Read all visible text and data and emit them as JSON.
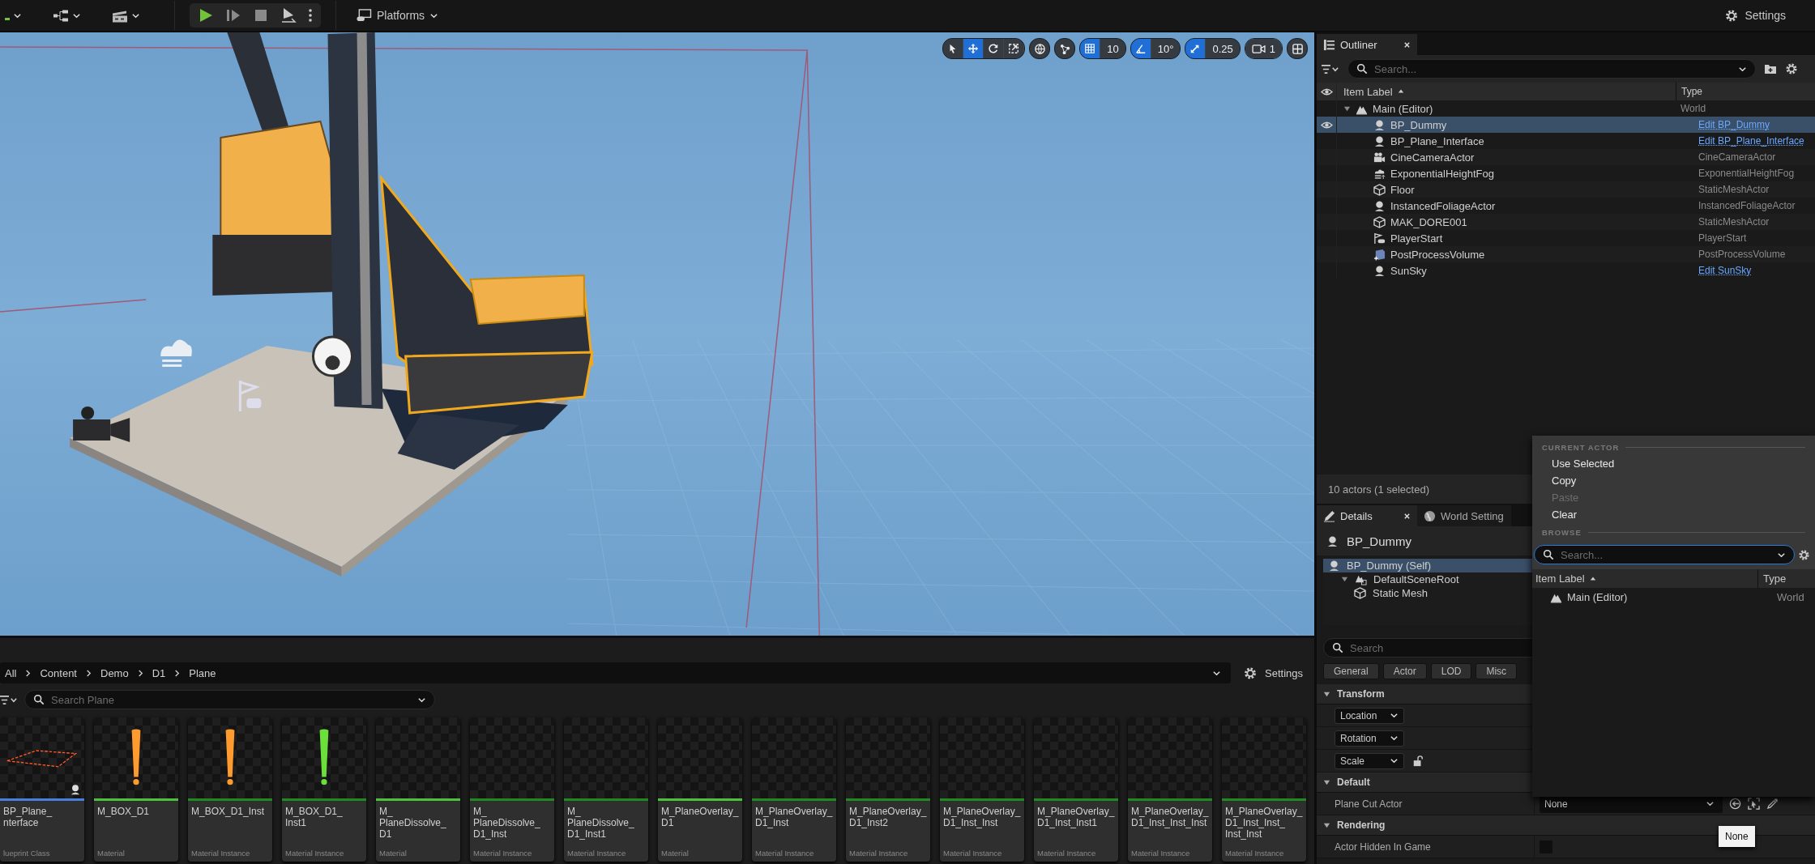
{
  "toolbar": {
    "play_controls": [
      {
        "kind": "play"
      },
      {
        "kind": "frame_skip"
      },
      {
        "kind": "stop"
      },
      {
        "kind": "eject"
      },
      {
        "kind": "more"
      }
    ],
    "platforms": "Platforms",
    "settings": "Settings"
  },
  "viewport": {
    "tools": [
      {
        "kind": "select",
        "selected": false
      },
      {
        "kind": "translate",
        "selected": true
      },
      {
        "kind": "rotate",
        "selected": false
      },
      {
        "kind": "scale",
        "selected": false
      }
    ],
    "snaps": [
      {
        "kind": "grid",
        "on": true,
        "value": "10"
      },
      {
        "kind": "angle",
        "on": true,
        "value": "10°"
      },
      {
        "kind": "scale",
        "on": true,
        "value": "0.25"
      }
    ],
    "camera_speed": "1"
  },
  "outliner": {
    "title": "Outliner",
    "search_placeholder": "Search...",
    "columns": [
      "Item Label",
      "Type"
    ],
    "tree": [
      {
        "label": "Main (Editor)",
        "kind": "world",
        "type": "World",
        "type_link": false,
        "selected": false,
        "expanded": true,
        "children": [
          {
            "label": "BP_Dummy",
            "kind": "actor",
            "type": "Edit BP_Dummy",
            "type_link": true,
            "selected": true
          },
          {
            "label": "BP_Plane_Interface",
            "kind": "actor",
            "type": "Edit BP_Plane_Interface",
            "type_link": true,
            "selected": false
          },
          {
            "label": "CineCameraActor",
            "kind": "camera",
            "type": "CineCameraActor",
            "type_link": false,
            "selected": false
          },
          {
            "label": "ExponentialHeightFog",
            "kind": "fog",
            "type": "ExponentialHeightFog",
            "type_link": false,
            "selected": false
          },
          {
            "label": "Floor",
            "kind": "mesh",
            "type": "StaticMeshActor",
            "type_link": false,
            "selected": false
          },
          {
            "label": "InstancedFoliageActor",
            "kind": "actor",
            "type": "InstancedFoliageActor",
            "type_link": false,
            "selected": false
          },
          {
            "label": "MAK_DORE001",
            "kind": "mesh",
            "type": "StaticMeshActor",
            "type_link": false,
            "selected": false
          },
          {
            "label": "PlayerStart",
            "kind": "player_start",
            "type": "PlayerStart",
            "type_link": false,
            "selected": false
          },
          {
            "label": "PostProcessVolume",
            "kind": "volume",
            "type": "PostProcessVolume",
            "type_link": false,
            "selected": false
          },
          {
            "label": "SunSky",
            "kind": "actor",
            "type": "Edit SunSky",
            "type_link": true,
            "selected": false
          }
        ]
      }
    ],
    "status": "10 actors (1 selected)"
  },
  "details": {
    "tabs": [
      {
        "label": "Details",
        "kind": "pencil",
        "selected": true
      },
      {
        "label": "World Setting",
        "kind": "globe",
        "selected": false
      }
    ],
    "title": "BP_Dummy",
    "components": [
      {
        "label": "BP_Dummy (Self)",
        "kind": "actor",
        "selected": true,
        "children": [
          {
            "label": "DefaultSceneRoot",
            "kind": "scene_root",
            "selected": false,
            "expanded": true,
            "children": [
              {
                "label": "Static Mesh",
                "kind": "mesh",
                "selected": false
              }
            ]
          }
        ]
      }
    ],
    "search_placeholder": "Search",
    "filters": [
      "General",
      "Actor",
      "LOD",
      "Misc"
    ],
    "sections": [
      {
        "title": "Transform",
        "expanded": true,
        "rows": [
          {
            "kind": "transform",
            "label": "Location"
          },
          {
            "kind": "transform",
            "label": "Rotation"
          },
          {
            "kind": "transform",
            "label": "Scale",
            "locked": false
          }
        ]
      },
      {
        "title": "Default",
        "expanded": true,
        "rows": [
          {
            "kind": "object",
            "label": "Plane Cut Actor",
            "value": "None"
          }
        ]
      },
      {
        "title": "Rendering",
        "expanded": true,
        "rows": [
          {
            "kind": "checkbox",
            "label": "Actor Hidden In Game",
            "checked": false
          }
        ]
      }
    ]
  },
  "picker": {
    "current_actor": {
      "heading": "CURRENT ACTOR",
      "items": [
        {
          "label": "Use Selected",
          "disabled": false
        },
        {
          "label": "Copy",
          "disabled": false
        },
        {
          "label": "Paste",
          "disabled": true
        },
        {
          "label": "Clear",
          "disabled": false
        }
      ]
    },
    "browse": {
      "heading": "BROWSE",
      "search_placeholder": "Search...",
      "columns": [
        "Item Label",
        "Type"
      ],
      "rows": [
        {
          "label": "Main (Editor)",
          "kind": "world",
          "type": "World"
        }
      ]
    },
    "tooltip": "None"
  },
  "content_browser": {
    "path": [
      "All",
      "Content",
      "Demo",
      "D1",
      "Plane"
    ],
    "settings": "Settings",
    "search_placeholder": "Search Plane",
    "assets": [
      {
        "name": "BP_Plane_nterface",
        "type": "lueprint Class",
        "kind": "blueprint"
      },
      {
        "name": "M_BOX_D1",
        "type": "Material",
        "kind": "material",
        "color": "#ff9a2e"
      },
      {
        "name": "M_BOX_D1_Inst",
        "type": "Material Instance",
        "kind": "material_instance",
        "color": "#ff9a2e"
      },
      {
        "name": "M_BOX_D1_Inst1",
        "type": "Material Instance",
        "kind": "material_instance",
        "color": "#6be03a"
      },
      {
        "name": "M_PlaneDissolve_D1",
        "type": "Material",
        "kind": "material"
      },
      {
        "name": "M_PlaneDissolve_D1_Inst",
        "type": "Material Instance",
        "kind": "material_instance"
      },
      {
        "name": "M_PlaneDissolve_D1_Inst1",
        "type": "Material Instance",
        "kind": "material_instance"
      },
      {
        "name": "M_PlaneOverlay_D1",
        "type": "Material",
        "kind": "material"
      },
      {
        "name": "M_PlaneOverlay_D1_Inst",
        "type": "Material Instance",
        "kind": "material_instance"
      },
      {
        "name": "M_PlaneOverlay_D1_Inst2",
        "type": "Material Instance",
        "kind": "material_instance"
      },
      {
        "name": "M_PlaneOverlay_D1_Inst_Inst",
        "type": "Material Instance",
        "kind": "material_instance"
      },
      {
        "name": "M_PlaneOverlay_D1_Inst_Inst1",
        "type": "Material Instance",
        "kind": "material_instance"
      },
      {
        "name": "M_PlaneOverlay_D1_Inst_Inst_Inst",
        "type": "Material Instance",
        "kind": "material_instance"
      },
      {
        "name": "M_PlaneOverlay_D1_Inst_Inst_Inst_Inst",
        "type": "Material Instance",
        "kind": "material_instance"
      }
    ]
  }
}
